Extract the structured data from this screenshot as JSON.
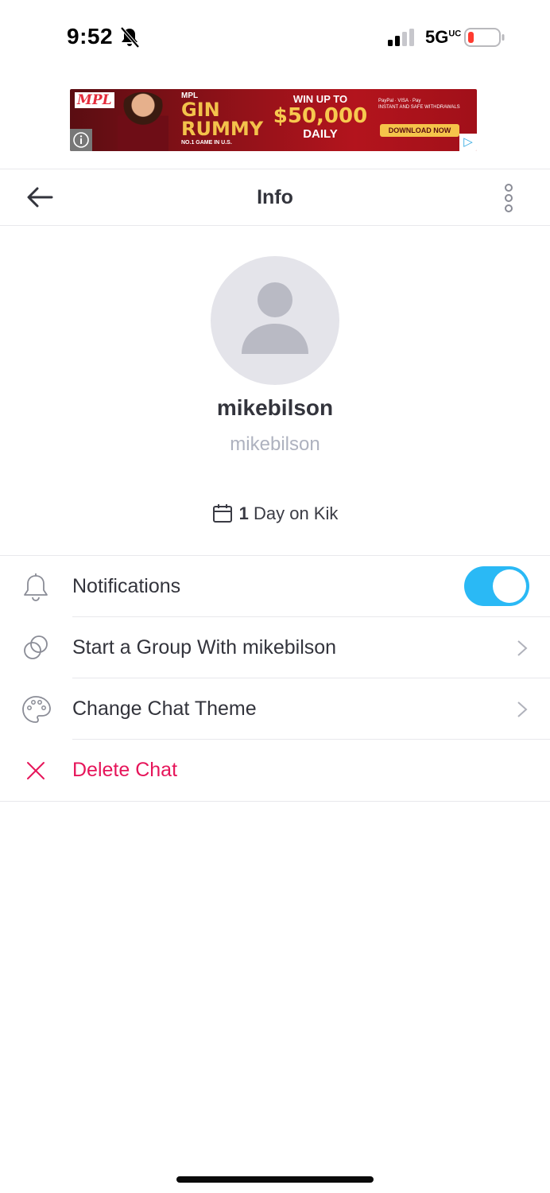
{
  "status_bar": {
    "time": "9:52",
    "network": "5G",
    "network_suffix": "UC"
  },
  "ad": {
    "brand": "MPL",
    "game_top": "MPL",
    "game_line1": "GIN",
    "game_line2": "RUMMY",
    "game_tag": "NO.1 GAME IN U.S.",
    "win_line1": "WIN UP TO",
    "win_amount": "$50,000",
    "win_line3": "DAILY",
    "payments": "PayPal · VISA · Pay",
    "withdraw": "INSTANT AND SAFE WITHDRAWALS",
    "cta": "DOWNLOAD NOW"
  },
  "header": {
    "title": "Info"
  },
  "profile": {
    "display_name": "mikebilson",
    "username": "mikebilson",
    "days_count": "1",
    "days_text": "Day on Kik"
  },
  "menu": {
    "notifications_label": "Notifications",
    "notifications_on": true,
    "start_group_label": "Start a Group With mikebilson",
    "change_theme_label": "Change Chat Theme",
    "delete_label": "Delete Chat"
  },
  "colors": {
    "accent": "#2ab9f5",
    "danger": "#e6155a",
    "secondary_text": "#aeb2bf"
  }
}
